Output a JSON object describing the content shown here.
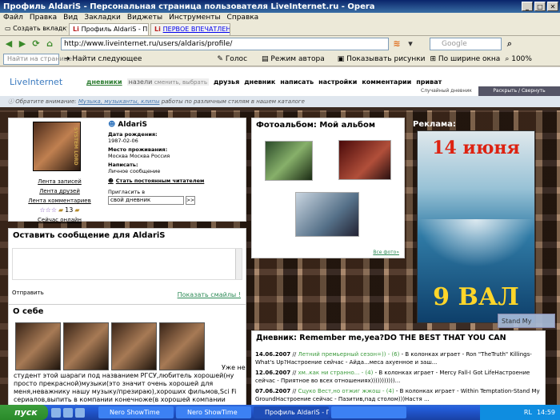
{
  "window": {
    "title": "Профиль AldariS - Персональная страница пользователя LiveInternet.ru - Opera"
  },
  "menu": [
    "Файл",
    "Правка",
    "Вид",
    "Закладки",
    "Виджеты",
    "Инструменты",
    "Справка"
  ],
  "tabs": {
    "new_tab": "Создать вкладку",
    "items": [
      {
        "label": "Профиль AldariS - П..."
      },
      {
        "label": "ПЕРВОЕ ВПЕЧАТЛЕН..."
      }
    ]
  },
  "address": {
    "url": "http://www.liveinternet.ru/users/aldaris/profile/",
    "search_placeholder": "Google"
  },
  "toolbar": {
    "find_placeholder": "Найти на странице",
    "find_next": "Найти следующее",
    "voice": "Голос",
    "author_mode": "Режим автора",
    "show_images": "Показывать рисунки",
    "fit_width": "По ширине окна",
    "zoom": "100%"
  },
  "site": {
    "logo": "LiveInternet",
    "nav": {
      "current": "дневники",
      "section": "назели",
      "section_small": "сменить, выбрать",
      "links": [
        "друзья",
        "дневник",
        "написать",
        "настройки",
        "комментарии",
        "приват"
      ]
    },
    "random": "Случайный дневник",
    "expand": "Раскрыть / Свернуть",
    "notice_label": "Обратите внимание:",
    "notice_link": "Музыка, музыканты, клипы",
    "notice_text": "работы по различным стилям в нашем каталоге"
  },
  "profile": {
    "username": "AldariS",
    "birth_label": "Дата рождения:",
    "birth_value": "1987-02-06",
    "location_label": "Место проживания:",
    "location_value": "Москва Москва Россия",
    "write_label": "Написать:",
    "write_value": "Личное сообщение",
    "subscribe": "Стать постоянным читателем",
    "invite_label": "Пригласить в",
    "invite_value": "свой дневник",
    "invite_btn": ">>",
    "avatar_caption": "SYSTEM LORD",
    "links": [
      "Лента записей",
      "Лента друзей",
      "Лента комментариев"
    ],
    "stars": "☆☆☆",
    "rating": "13",
    "online": "Сейчас онлайн"
  },
  "message": {
    "title": "Оставить сообщение для AldariS",
    "send": "Отправить",
    "smiles": "Показать смайлы !"
  },
  "about": {
    "title": "О себе",
    "more": "Уже не",
    "text": "студент этой шараги под названием РГСУ,любитель хорошей(ну просто прекрасной)музыки(это значит очень хорошей для меня,неважнику нашу музыку/презираю),хороших фильмов,Sci Fi сериалов,выпить в компании конечноже(в хорошей компании всегда хорошо пьётся и разговаривается)не"
  },
  "album": {
    "title": "Фотоальбом: Мой альбом",
    "all": "Все фото»"
  },
  "ad": {
    "title": "Реклама:",
    "poster_date": "14 июня",
    "poster_title": "9 ВАЛ"
  },
  "diary": {
    "title": "Дневник: Remember me,yea?DO THE BEST THAT YOU CAN",
    "entries": [
      {
        "date": "14.06.2007",
        "sep": "//",
        "title": "Летний премьерный сезон=))",
        "count": "- (6)",
        "text": "- В колонках играет - Ron \"TheTruth\" Killings-What's Up?Настроение сейчас - Айда...меса ахуенное и заш..."
      },
      {
        "date": "12.06.2007",
        "sep": "//",
        "title": "хм..как ни странно...",
        "count": "- (4)",
        "text": "- В колонках играет - Mercy Fall-I Got LifeНастроение сейчас - Приятное во всех отношениях)))))))))))..."
      },
      {
        "date": "07.06.2007",
        "sep": "//",
        "title": "Сцуко Вест,но отжиг жжош",
        "count": "- (4)",
        "text": "- В колонках играет - Within Temptation-Stand My GroundНастроение сейчас - Пазитив,пад столом)))Настя ..."
      }
    ],
    "popup": "Stand My"
  },
  "taskbar": {
    "start": "пуск",
    "tasks": [
      "Nero ShowTime",
      "Nero ShowTime",
      "Профиль AldariS - Пе...",
      ""
    ],
    "lang": "RL",
    "clock": "14:59"
  }
}
